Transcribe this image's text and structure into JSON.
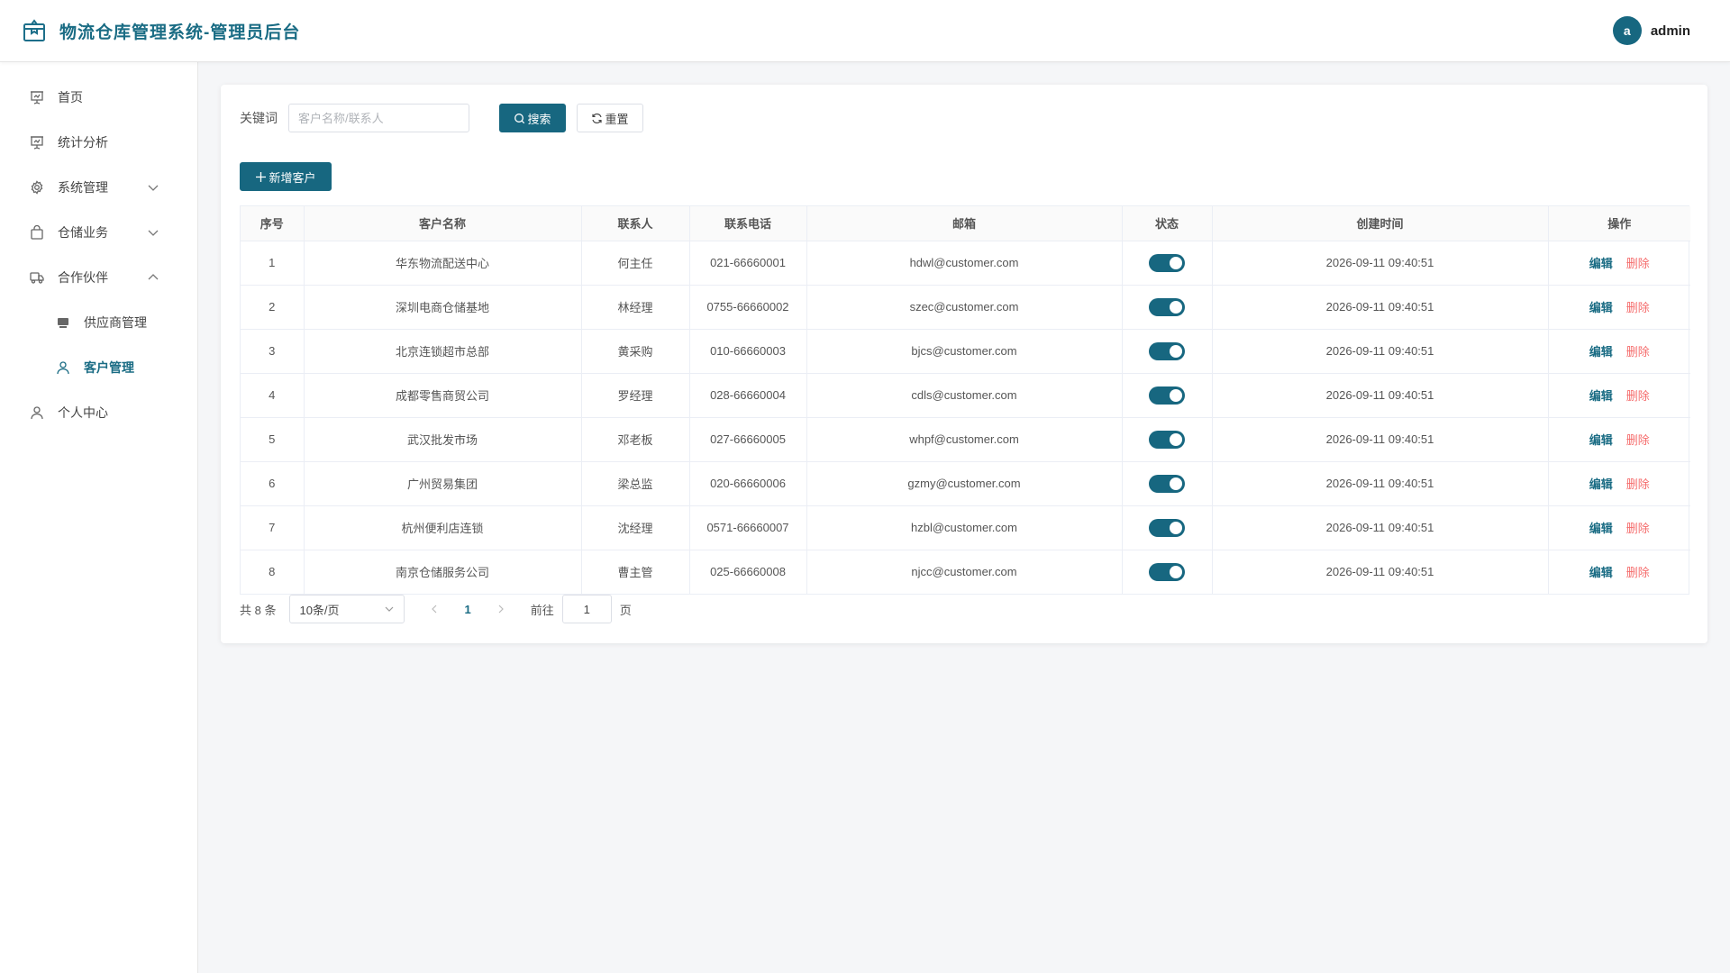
{
  "header": {
    "title": "物流仓库管理系统-管理员后台",
    "user": {
      "avatar_letter": "a",
      "name": "admin"
    }
  },
  "sidebar": {
    "items": [
      {
        "label": "首页",
        "icon": "presentation-icon"
      },
      {
        "label": "统计分析",
        "icon": "presentation-icon"
      },
      {
        "label": "系统管理",
        "icon": "gear-icon",
        "expanded": false
      },
      {
        "label": "仓储业务",
        "icon": "bag-icon",
        "expanded": false
      },
      {
        "label": "合作伙伴",
        "icon": "truck-icon",
        "expanded": true,
        "children": [
          {
            "label": "供应商管理",
            "icon": "box-icon"
          },
          {
            "label": "客户管理",
            "icon": "user-icon",
            "active": true
          }
        ]
      },
      {
        "label": "个人中心",
        "icon": "user-icon"
      }
    ]
  },
  "search": {
    "label": "关键词",
    "placeholder": "客户名称/联系人",
    "value": "",
    "search_button": "搜索",
    "reset_button": "重置"
  },
  "toolbar": {
    "add_button": "新增客户"
  },
  "table": {
    "columns": [
      "序号",
      "客户名称",
      "联系人",
      "联系电话",
      "邮箱",
      "状态",
      "创建时间",
      "操作"
    ],
    "rows": [
      {
        "no": "1",
        "name": "华东物流配送中心",
        "contact": "何主任",
        "phone": "021-66660001",
        "email": "hdwl@customer.com",
        "status": true,
        "created": "2026-09-11 09:40:51"
      },
      {
        "no": "2",
        "name": "深圳电商仓储基地",
        "contact": "林经理",
        "phone": "0755-66660002",
        "email": "szec@customer.com",
        "status": true,
        "created": "2026-09-11 09:40:51"
      },
      {
        "no": "3",
        "name": "北京连锁超市总部",
        "contact": "黄采购",
        "phone": "010-66660003",
        "email": "bjcs@customer.com",
        "status": true,
        "created": "2026-09-11 09:40:51"
      },
      {
        "no": "4",
        "name": "成都零售商贸公司",
        "contact": "罗经理",
        "phone": "028-66660004",
        "email": "cdls@customer.com",
        "status": true,
        "created": "2026-09-11 09:40:51"
      },
      {
        "no": "5",
        "name": "武汉批发市场",
        "contact": "邓老板",
        "phone": "027-66660005",
        "email": "whpf@customer.com",
        "status": true,
        "created": "2026-09-11 09:40:51"
      },
      {
        "no": "6",
        "name": "广州贸易集团",
        "contact": "梁总监",
        "phone": "020-66660006",
        "email": "gzmy@customer.com",
        "status": true,
        "created": "2026-09-11 09:40:51"
      },
      {
        "no": "7",
        "name": "杭州便利店连锁",
        "contact": "沈经理",
        "phone": "0571-66660007",
        "email": "hzbl@customer.com",
        "status": true,
        "created": "2026-09-11 09:40:51"
      },
      {
        "no": "8",
        "name": "南京仓储服务公司",
        "contact": "曹主管",
        "phone": "025-66660008",
        "email": "njcc@customer.com",
        "status": true,
        "created": "2026-09-11 09:40:51"
      }
    ],
    "edit_label": "编辑",
    "delete_label": "删除"
  },
  "pagination": {
    "total_text": "共 8 条",
    "page_size": "10条/页",
    "current_page": "1",
    "goto_label": "前往",
    "goto_value": "1",
    "goto_suffix": "页"
  },
  "colors": {
    "primary": "#176780",
    "danger": "#f56c6c"
  }
}
